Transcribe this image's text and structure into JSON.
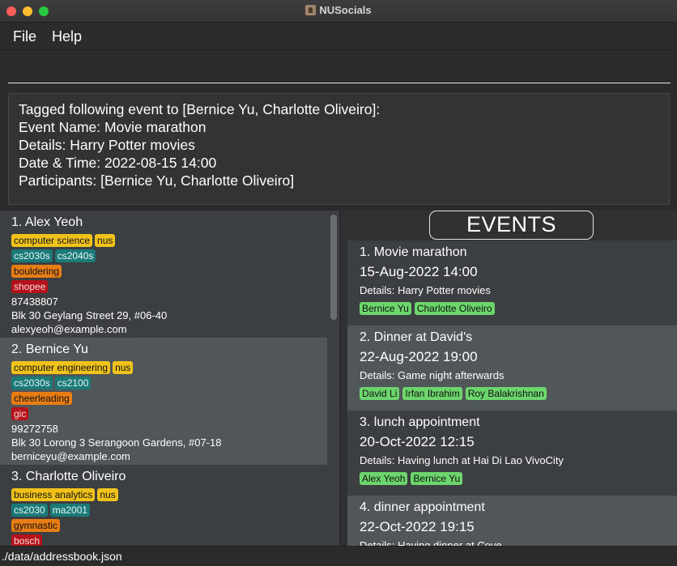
{
  "window": {
    "title": "NUSocials"
  },
  "menu": {
    "file": "File",
    "help": "Help"
  },
  "command": {
    "value": "",
    "placeholder": ""
  },
  "result": {
    "lines": [
      "Tagged following event to [Bernice Yu, Charlotte Oliveiro]:",
      "Event Name: Movie marathon",
      "Details: Harry Potter movies",
      "Date & Time: 2022-08-15 14:00",
      "Participants: [Bernice Yu, Charlotte Oliveiro]"
    ]
  },
  "persons": [
    {
      "name": "1.  Alex Yeoh",
      "tags_yellow": [
        "computer science",
        "nus"
      ],
      "tags_teal": [
        "cs2030s",
        "cs2040s"
      ],
      "tags_orange": [
        "bouldering"
      ],
      "tags_red": [
        "shopee"
      ],
      "phone": "87438807",
      "address": "Blk 30 Geylang Street 29, #06-40",
      "email": "alexyeoh@example.com"
    },
    {
      "name": "2.  Bernice Yu",
      "tags_yellow": [
        "computer engineering",
        "nus"
      ],
      "tags_teal": [
        "cs2030s",
        "cs2100"
      ],
      "tags_orange": [
        "cheerleading"
      ],
      "tags_red": [
        "gic"
      ],
      "phone": "99272758",
      "address": "Blk 30 Lorong 3 Serangoon Gardens, #07-18",
      "email": "berniceyu@example.com"
    },
    {
      "name": "3.  Charlotte Oliveiro",
      "tags_yellow": [
        "business analytics",
        "nus"
      ],
      "tags_teal": [
        "cs2030",
        "ma2001"
      ],
      "tags_orange": [
        "gymnastic"
      ],
      "tags_red": [
        "bosch"
      ],
      "phone": "",
      "address": "",
      "email": ""
    }
  ],
  "events_header": "EVENTS",
  "events": [
    {
      "name": "1.  Movie marathon",
      "date": "15-Aug-2022 14:00",
      "details": "Details: Harry Potter movies",
      "participants": [
        "Bernice Yu",
        "Charlotte Oliveiro"
      ]
    },
    {
      "name": "2.  Dinner at David's",
      "date": "22-Aug-2022 19:00",
      "details": "Details: Game night afterwards",
      "participants": [
        "David Li",
        "Irfan Ibrahim",
        "Roy Balakrishnan"
      ]
    },
    {
      "name": "3.  lunch appointment",
      "date": "20-Oct-2022 12:15",
      "details": "Details: Having lunch at Hai Di Lao VivoCity",
      "participants": [
        "Alex Yeoh",
        "Bernice Yu"
      ]
    },
    {
      "name": "4.  dinner appointment",
      "date": "22-Oct-2022 19:15",
      "details": "Details: Having dinner at Cove",
      "participants": []
    }
  ],
  "status": {
    "path": "./data/addressbook.json"
  },
  "colors": {
    "close": "#fe5f57",
    "minimize": "#febc2e",
    "maximize": "#28c840",
    "tag_yellow": "#f0c21a",
    "tag_teal": "#1a7a78",
    "tag_orange": "#e87d14",
    "tag_red": "#b5121b",
    "participant_tag": "#6cd66c",
    "selected_card": "#515658"
  }
}
